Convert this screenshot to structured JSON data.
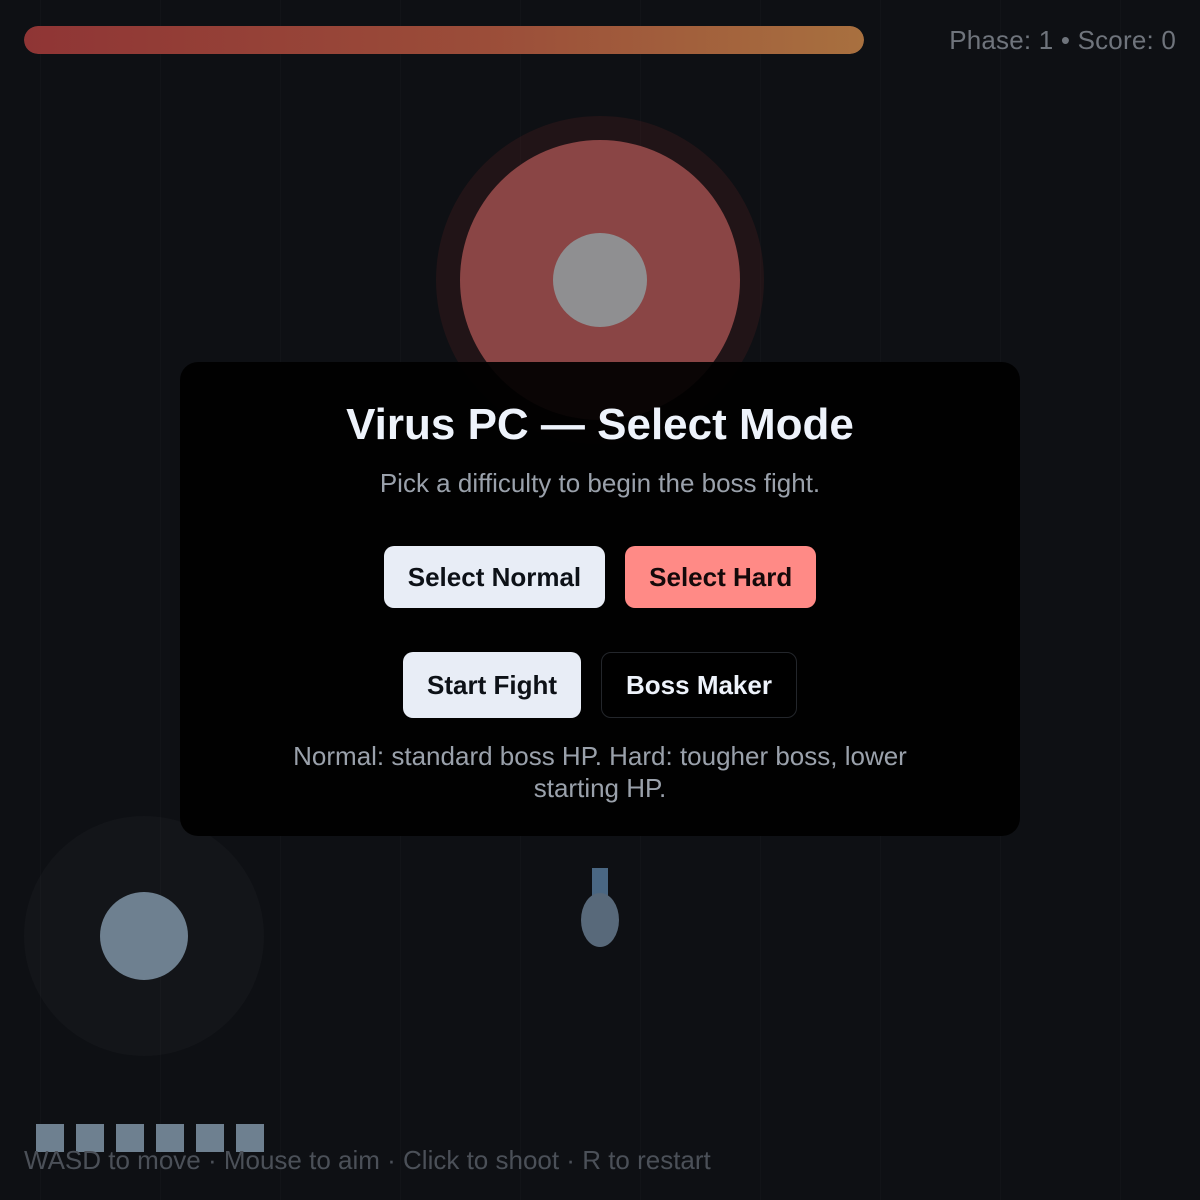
{
  "hud": {
    "boss_hp_fraction": 0.7,
    "phase_score_text": "Phase: 1 • Score: 0"
  },
  "player": {
    "lives": 6
  },
  "footer": {
    "controls_hint": "WASD to move · Mouse to aim · Click to shoot · R to restart"
  },
  "overlay": {
    "title": "Virus PC — Select Mode",
    "subtitle": "Pick a difficulty to begin the boss fight.",
    "buttons": {
      "select_normal": "Select Normal",
      "select_hard": "Select Hard",
      "start_fight": "Start Fight",
      "boss_maker": "Boss Maker"
    },
    "note": "Normal: standard boss HP. Hard: tougher boss, lower starting HP."
  },
  "colors": {
    "background": "#0e1014",
    "boss": "#8a4545",
    "boss_core": "#8f8f91",
    "player": "#6e8090",
    "hard_button": "#ff8a86",
    "light_button": "#e8edf6"
  }
}
